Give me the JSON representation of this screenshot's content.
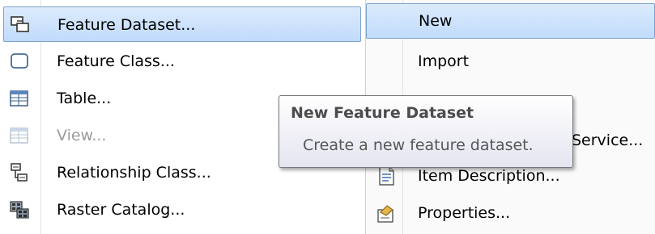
{
  "left_menu": {
    "items": [
      {
        "label": "Feature Dataset...",
        "icon": "feature-dataset-icon",
        "highlighted": true
      },
      {
        "label": "Feature Class...",
        "icon": "feature-class-icon"
      },
      {
        "label": "Table...",
        "icon": "table-icon"
      },
      {
        "label": "View...",
        "icon": "view-icon",
        "disabled": true
      },
      {
        "label": "Relationship Class...",
        "icon": "relationship-class-icon"
      },
      {
        "label": "Raster Catalog...",
        "icon": "raster-catalog-icon"
      }
    ]
  },
  "right_menu": {
    "items": [
      {
        "label": "New",
        "highlighted": true
      },
      {
        "label": "Import"
      },
      {
        "label": "Service..."
      },
      {
        "label": "Item Description...",
        "icon": "item-description-icon"
      },
      {
        "label": "Properties...",
        "icon": "properties-icon"
      }
    ]
  },
  "tooltip": {
    "title": "New Feature Dataset",
    "body": "Create a new feature dataset."
  },
  "colors": {
    "highlight_border": "#7da2ce",
    "highlight_fill": "#c1dbfc"
  }
}
